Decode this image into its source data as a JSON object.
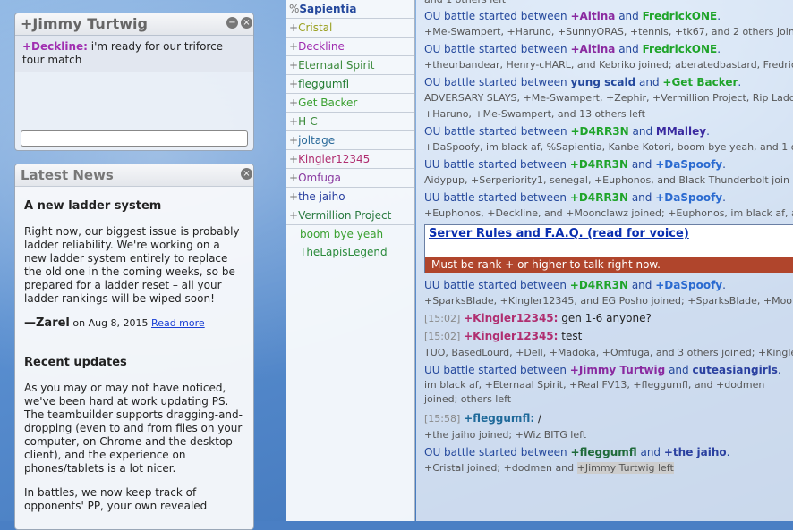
{
  "pm": {
    "title": "+Jimmy Turtwig",
    "message_user": "+Deckline:",
    "message_text": " i'm ready for our triforce tour match",
    "minimize_glyph": "−",
    "close_glyph": "×",
    "input_value": ""
  },
  "news": {
    "title": "Latest News",
    "close_glyph": "×",
    "article1": {
      "heading": "A new ladder system",
      "body": "Right now, our biggest issue is probably ladder reliability. We're working on a new ladder system entirely to replace the old one in the coming weeks, so be prepared for a ladder reset – all your ladder rankings will be wiped soon!",
      "author": "—Zarel",
      "date": " on Aug 8, 2015 ",
      "more": "Read more"
    },
    "article2": {
      "heading": "Recent updates",
      "p1": "As you may or may not have noticed, we've been hard at work updating PS. The teambuilder supports dragging-and-dropping (even to and from files on your computer, on Chrome and the desktop client), and the experience on phones/tablets is a lot nicer.",
      "p2": "In battles, we now keep track of opponents' PP, your own revealed"
    }
  },
  "userlist": [
    {
      "rank": "%",
      "name": "Sapientia",
      "color": "#24489c",
      "bold": true
    },
    {
      "rank": "+",
      "name": "Cristal",
      "color": "#9aa020"
    },
    {
      "rank": "+",
      "name": "Deckline",
      "color": "#a02eb0"
    },
    {
      "rank": "+",
      "name": "Eternaal Spirit",
      "color": "#3c8a3c"
    },
    {
      "rank": "+",
      "name": "fleggumfl",
      "color": "#1f7a2f"
    },
    {
      "rank": "+",
      "name": "Get Backer",
      "color": "#3aa030"
    },
    {
      "rank": "+",
      "name": "H-C",
      "color": "#3a8a3a"
    },
    {
      "rank": "+",
      "name": "joltage",
      "color": "#2a6a9a"
    },
    {
      "rank": "+",
      "name": "Kingler12345",
      "color": "#b02e70"
    },
    {
      "rank": "+",
      "name": "Omfuga",
      "color": "#8a3aa0"
    },
    {
      "rank": "+",
      "name": "the jaiho",
      "color": "#2a40a0"
    },
    {
      "rank": "+",
      "name": "Vermillion Project",
      "color": "#2a7a40"
    },
    {
      "rank": "",
      "name": "boom bye yeah",
      "color": "#3aa030"
    },
    {
      "rank": "",
      "name": "TheLapisLegend",
      "color": "#2a8a3a"
    }
  ],
  "chat": {
    "top_partial": "and 1 others left",
    "battle_prefix_ou": "OU battle started between ",
    "battle_prefix_uu": "UU battle started between ",
    "and": " and ",
    "dot": ".",
    "l1": {
      "p1": "+Altina",
      "p2": "FredrickONE"
    },
    "j1": "+Me-Swampert, +Haruno, +SunnyORAS, +tennis, +tk67, and 2 others joined",
    "l2": {
      "p1": "+Altina",
      "p2": "FredrickONE"
    },
    "j2": "+theurbandear, Henry-cHARL, and Kebriko joined; aberatedbastard, Fredric",
    "l3": {
      "p1": "yung scald",
      "p2": "+Get Backer"
    },
    "j3a": "ADVERSARY SLAYS, +Me-Swampert, +Zephir, +Vermillion Project, Rip Ladd",
    "j3b": "+Haruno, +Me-Swampert, and 13 others left",
    "l4": {
      "p1": "+D4RR3N",
      "p2": "MMalley"
    },
    "j4": "+DaSpoofy, im black af, %Sapientia, Kanbe Kotori, boom bye yeah, and 1 ot",
    "l5": {
      "p1": "+D4RR3N",
      "p2": "+DaSpoofy"
    },
    "j5": "Aidypup, +Serperiority1, senegal, +Euphonos, and Black Thunderbolt join",
    "l6": {
      "p1": "+D4RR3N",
      "p2": "+DaSpoofy"
    },
    "j6": "+Euphonos, +Deckline, and +Moonclawz joined; +Euphonos, im black af, a",
    "rules_link": "Server Rules and F.A.Q. (read for voice)",
    "modbar": "Must be rank + or higher to talk right now.",
    "l7": {
      "p1": "+D4RR3N",
      "p2": "+DaSpoofy"
    },
    "j7": "+SparksBlade, +Kingler12345, and EG Posho joined; +SparksBlade, +Moon",
    "c1": {
      "time": "[15:02]",
      "user": "+Kingler12345:",
      "text": " gen 1-6 anyone?"
    },
    "c2": {
      "time": "[15:02]",
      "user": "+Kingler12345:",
      "text": " test"
    },
    "j8": "TUO, BasedLourd, +Dell, +Madoka, +Omfuga, and 3 others joined; +Kingle",
    "l8": {
      "p1": "+Jimmy Turtwig",
      "p2": "cuteasiangirls"
    },
    "j9": "im black af, +Eternaal Spirit, +Real FV13, +fleggumfl, and +dodmen joined; others left",
    "c3": {
      "time": "[15:58]",
      "user": "+fleggumfl:",
      "text": " /"
    },
    "j10": "+the jaiho joined; +Wiz BITG left",
    "l9": {
      "p1": "+fleggumfl",
      "p2": "+the jaiho"
    },
    "j11a": "+Cristal joined; +dodmen and ",
    "j11b": "+Jimmy Turtwig left"
  },
  "colors": {
    "green": "#1fa42a",
    "purple": "#a02eb0",
    "blue": "#24489c",
    "navy": "#3a2aa0",
    "magenta": "#b02e70"
  }
}
